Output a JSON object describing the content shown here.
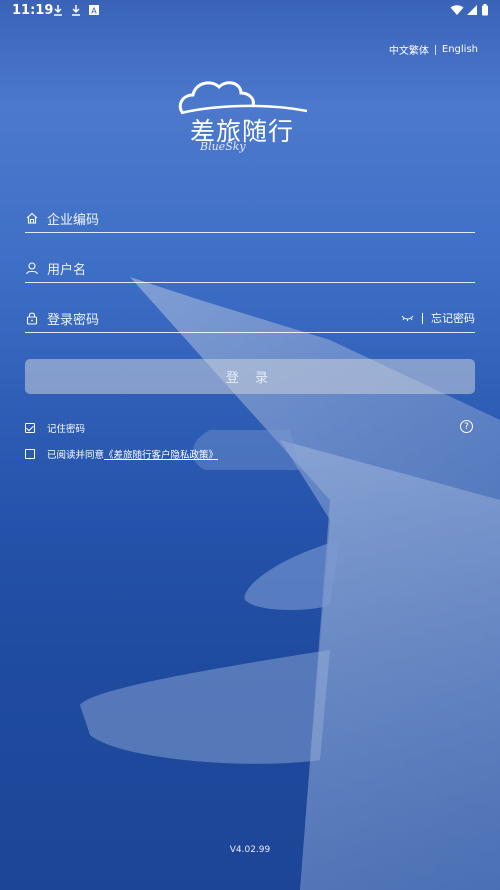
{
  "status_bar": {
    "time": "11:19",
    "icons": [
      "download-icon",
      "download-icon",
      "notification-a-icon",
      "wifi-icon",
      "signal-icon",
      "battery-icon"
    ]
  },
  "language": {
    "chinese_traditional": "中文繁体",
    "english": "English"
  },
  "logo": {
    "title": "差旅随行",
    "subtitle": "BlueSky"
  },
  "form": {
    "company_code_placeholder": "企业编码",
    "username_placeholder": "用户名",
    "password_placeholder": "登录密码",
    "forgot_password": "忘记密码",
    "login_label": "登 录"
  },
  "options": {
    "remember_password": "记住密码",
    "remember_checked": true,
    "agree_prefix": "已阅读并同意",
    "policy_link": "《差旅随行客户隐私政策》",
    "agree_checked": false
  },
  "version": "V4.02.99",
  "colors": {
    "background_top": "#3a63b8",
    "background_bottom": "#1d4597",
    "button_bg": "#c8d0dc"
  }
}
